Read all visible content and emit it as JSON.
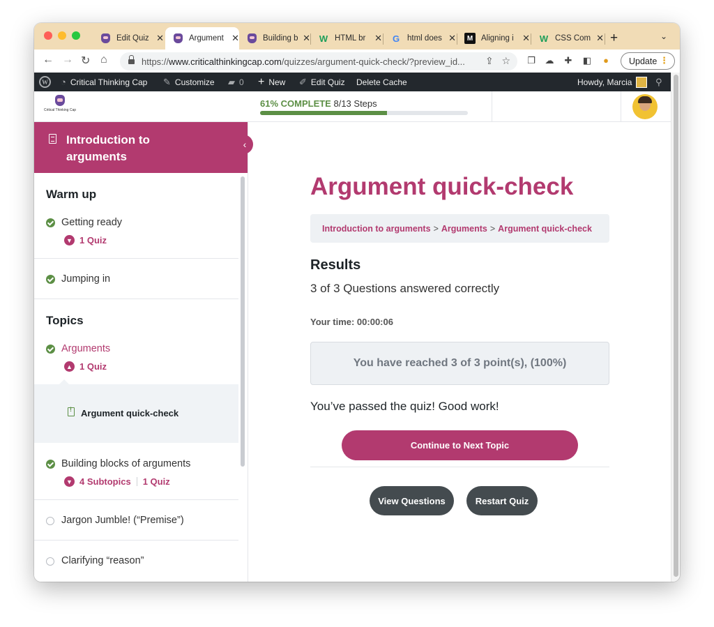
{
  "browser": {
    "tabs": [
      {
        "title": "Edit Quiz",
        "icon": "owl-favicon",
        "active": false
      },
      {
        "title": "Argument",
        "icon": "owl-favicon",
        "active": true
      },
      {
        "title": "Building b",
        "icon": "owl-favicon",
        "active": false
      },
      {
        "title": "HTML br",
        "icon": "w3-favicon",
        "active": false
      },
      {
        "title": "html does",
        "icon": "google-favicon",
        "active": false
      },
      {
        "title": "Aligning i",
        "icon": "m-favicon",
        "active": false
      },
      {
        "title": "CSS Com",
        "icon": "w3-favicon",
        "active": false
      }
    ],
    "new_tab": "+",
    "url_prefix": "https://",
    "url_domain": "www.criticalthinkingcap.com",
    "url_path": "/quizzes/argument-quick-check/?preview_id...",
    "update_label": "Update",
    "update_dots": "⋮"
  },
  "adminbar": {
    "wp": "W",
    "site": "Critical Thinking Cap",
    "customize": "Customize",
    "comments": "0",
    "new": "New",
    "edit": "Edit Quiz",
    "cache": "Delete Cache",
    "howdy": "Howdy, Marcia"
  },
  "header": {
    "logo_text": "Critical Thinking Cap",
    "progress_pct_label": "61% COMPLETE",
    "progress_steps": "8/13 Steps",
    "progress_value": 0.61
  },
  "sidebar": {
    "course_title": "Introduction to arguments",
    "collapse_icon": "‹",
    "sections": [
      {
        "heading": "Warm up"
      },
      {
        "heading": "Topics"
      }
    ],
    "lessons": {
      "getting_ready": {
        "title": "Getting ready",
        "quiz": "1 Quiz",
        "status": "complete"
      },
      "jumping_in": {
        "title": "Jumping in",
        "status": "complete"
      },
      "arguments": {
        "title": "Arguments",
        "quiz": "1 Quiz",
        "status": "complete"
      },
      "quick_check": {
        "title": "Argument quick-check"
      },
      "building_blocks": {
        "title": "Building blocks of arguments",
        "subtopics": "4 Subtopics",
        "quiz": "1 Quiz",
        "status": "complete"
      },
      "jargon": {
        "title": "Jargon Jumble! (“Premise”)",
        "status": "incomplete"
      },
      "clarifying": {
        "title": "Clarifying “reason”",
        "status": "incomplete"
      }
    }
  },
  "main": {
    "title": "Argument quick-check",
    "breadcrumb": [
      "Introduction to arguments",
      "Arguments",
      "Argument quick-check"
    ],
    "breadcrumb_sep": ">",
    "results_heading": "Results",
    "answered": "3 of 3 Questions answered correctly",
    "time": "Your time: 00:00:06",
    "points": "You have reached 3 of 3 point(s), (100%)",
    "passed": "You’ve passed the quiz! Good work!",
    "continue_label": "Continue to Next Topic",
    "view_questions_label": "View Questions",
    "restart_label": "Restart Quiz"
  },
  "colors": {
    "brand": "#b23a6f",
    "success": "#5c8f45",
    "dark_button": "#444b4f",
    "tabstrip": "#f1dcb6"
  }
}
